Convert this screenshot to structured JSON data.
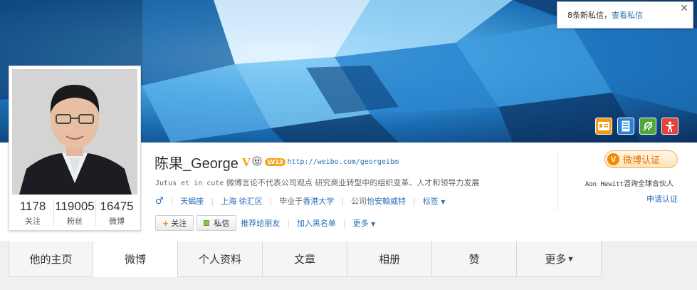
{
  "notification": {
    "text": "8条新私信，",
    "link": "查看私信",
    "close": "✕"
  },
  "profile": {
    "name": "陈果_George",
    "verified_mark": "V",
    "level": "LV13",
    "url": "http://weibo.com/georgeibm",
    "bio_en": "Jutus et in cute",
    "bio_cn": " 微博言论不代表公司观点 研究商业转型中的组织变革、人才和领导力发展",
    "gender": "♂",
    "constellation": "天蝎座",
    "location": "上海 徐汇区",
    "education_label": "毕业于",
    "school": "香港大学",
    "company_label": "公司",
    "company": "怡安翰威特",
    "tags": "标签"
  },
  "stats": [
    {
      "num": "1178",
      "label": "关注"
    },
    {
      "num": "119005",
      "label": "粉丝"
    },
    {
      "num": "16475",
      "label": "微博"
    }
  ],
  "actions": {
    "follow": "关注",
    "message": "私信",
    "recommend": "推荐给朋友",
    "blacklist": "加入黑名单",
    "more": "更多"
  },
  "verification": {
    "badge": "微博认证",
    "company_en": "Aon Hewitt",
    "company_cn": "咨询全球合伙人",
    "apply": "申请认证"
  },
  "tabs": [
    {
      "label": "他的主页"
    },
    {
      "label": "微博"
    },
    {
      "label": "个人资料"
    },
    {
      "label": "文章"
    },
    {
      "label": "相册"
    },
    {
      "label": "赞"
    },
    {
      "label": "更多"
    }
  ],
  "colors": {
    "link": "#2a6fb6",
    "accent_orange": "#f08a00"
  }
}
